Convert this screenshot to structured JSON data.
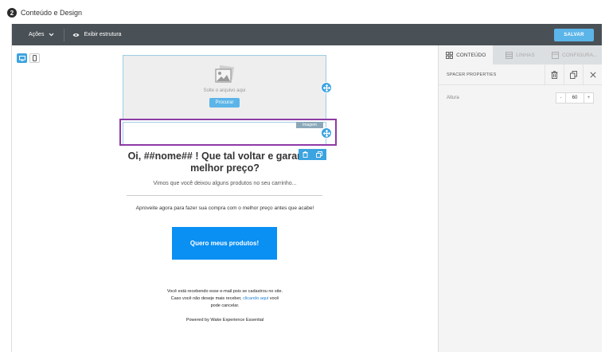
{
  "step": {
    "number": "2",
    "title": "Conteúdo e Design"
  },
  "toolbar": {
    "actions_label": "Ações",
    "structure_label": "Exibir estrutura",
    "save_label": "SALVAR"
  },
  "image_block": {
    "drop_text": "Solte o arquivo aqui",
    "browse_label": "Procurar",
    "tag_label": "Imagem"
  },
  "email": {
    "headline": "Oi, ##nome## ! Que tal voltar e garantir o melhor preço?",
    "subtitle": "Vimos que você deixou alguns produtos no seu carrinho...",
    "body": "Aproveite agora para fazer sua compra com o melhor preço antes que acabe!",
    "cta": "Quero meus produtos!",
    "footer_line1": "Você está recebendo esse e-mail pois se cadastrou no site.",
    "footer_line2_pre": "Caso você não deseje mais receber,",
    "footer_link": "clicando aqui",
    "footer_line2_post": "você",
    "footer_line3": "pode cancelar.",
    "powered": "Powered by Wake Experience Essential"
  },
  "panel": {
    "tabs": [
      {
        "label": "CONTEÚDO",
        "icon": "grid-icon",
        "active": true
      },
      {
        "label": "LINHAS",
        "icon": "rows-icon",
        "active": false
      },
      {
        "label": "CONFIGURA...",
        "icon": "settings-icon",
        "active": false
      }
    ],
    "title": "SPACER PROPERTIES",
    "height_label": "Altura",
    "height_value": "60",
    "minus": "-",
    "plus": "+"
  },
  "colors": {
    "accent": "#3ba3e0",
    "selection": "#8e3aa6",
    "toolbar": "#4a5156",
    "cta": "#0a8ff3"
  }
}
